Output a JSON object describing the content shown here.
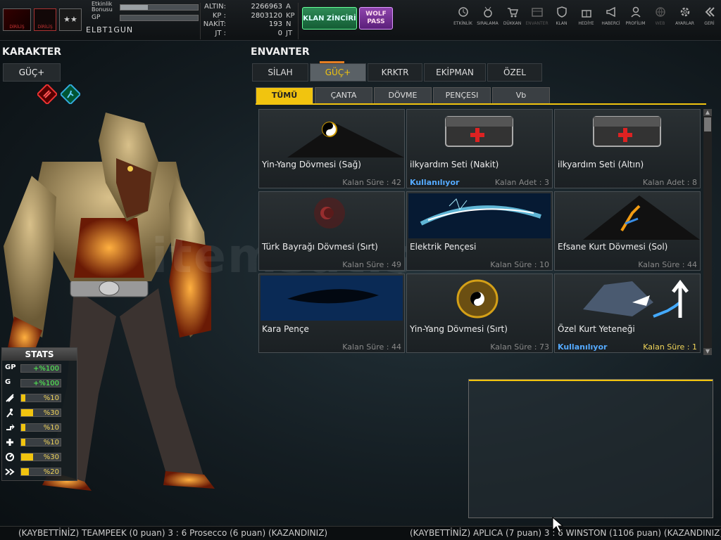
{
  "topbar": {
    "level": {
      "event_bonus_label": "Etkinlik Bonusu",
      "gp_label": "GP",
      "event_bonus_fill": 0.35,
      "gp_fill": 0.0
    },
    "username": "ELBT1GUN",
    "currency": [
      {
        "key": "ALTIN:",
        "value": "2266963",
        "unit": "A"
      },
      {
        "key": "KP :",
        "value": "2803120",
        "unit": "KP"
      },
      {
        "key": "NAKİT:",
        "value": "193",
        "unit": "N"
      },
      {
        "key": "JT :",
        "value": "0",
        "unit": "JT"
      }
    ],
    "klan_zinciri": "KLAN ZİNCİRİ",
    "wolf_pass_line1": "WOLF",
    "wolf_pass_line2": "PASS",
    "nav": [
      {
        "label": "ETKİNLİK",
        "icon": "clock-icon"
      },
      {
        "label": "SIRALAMA",
        "icon": "medal-icon"
      },
      {
        "label": "DÜKKAN",
        "icon": "cart-icon"
      },
      {
        "label": "ENVANTER",
        "icon": "inventory-icon"
      },
      {
        "label": "KLAN",
        "icon": "shield-icon"
      },
      {
        "label": "HEDİYE",
        "icon": "gift-icon"
      },
      {
        "label": "HABERCİ",
        "icon": "megaphone-icon"
      },
      {
        "label": "PROFİLIM",
        "icon": "profile-icon"
      },
      {
        "label": "WEB",
        "icon": "globe-icon"
      },
      {
        "label": "AYARLAR",
        "icon": "gear-icon"
      },
      {
        "label": "GERİ",
        "icon": "back-icon"
      }
    ]
  },
  "left": {
    "title": "KARAKTER",
    "tab": "GÜÇ+",
    "stats_title": "STATS",
    "stats": [
      {
        "icon": "GP",
        "value": "+%100",
        "fill": 0,
        "color": "green"
      },
      {
        "icon": "G",
        "value": "+%100",
        "fill": 0,
        "color": "green"
      },
      {
        "icon": "attack-icon",
        "value": "%10",
        "fill": 0.1,
        "color": "yellow"
      },
      {
        "icon": "run-icon",
        "value": "%30",
        "fill": 0.3,
        "color": "yellow"
      },
      {
        "icon": "jump-icon",
        "value": "%10",
        "fill": 0.1,
        "color": "yellow"
      },
      {
        "icon": "heal-icon",
        "value": "%10",
        "fill": 0.1,
        "color": "yellow"
      },
      {
        "icon": "speed-icon",
        "value": "%30",
        "fill": 0.3,
        "color": "yellow"
      },
      {
        "icon": "dash-icon",
        "value": "%20",
        "fill": 0.2,
        "color": "yellow"
      }
    ]
  },
  "inventory": {
    "title": "ENVANTER",
    "tabs": [
      "SİLAH",
      "GÜÇ+",
      "KRKTR",
      "EKİPMAN",
      "ÖZEL"
    ],
    "active_tab": 1,
    "subtabs": [
      "TÜMÜ",
      "ÇANTA",
      "DÖVME",
      "PENÇESI",
      "Vb"
    ],
    "active_subtab": 0,
    "items": [
      {
        "name": "Yin-Yang Dövmesi (Sağ)",
        "status": "",
        "remain": "Kalan Süre : 42",
        "img": "yinyang-tattoo"
      },
      {
        "name": "ilkyardım Seti (Nakit)",
        "status": "Kullanılıyor",
        "remain": "Kalan Adet : 3",
        "img": "medkit"
      },
      {
        "name": "ilkyardım Seti (Altın)",
        "status": "",
        "remain": "Kalan Adet : 8",
        "img": "medkit"
      },
      {
        "name": "Türk Bayrağı Dövmesi (Sırt)",
        "status": "",
        "remain": "Kalan Süre : 49",
        "img": "turkish-flag-tattoo"
      },
      {
        "name": "Elektrik Pençesi",
        "status": "",
        "remain": "Kalan Süre : 10",
        "img": "electric-claw"
      },
      {
        "name": "Efsane Kurt Dövmesi (Sol)",
        "status": "",
        "remain": "Kalan Süre : 44",
        "img": "wolf-tattoo"
      },
      {
        "name": "Kara Pençe",
        "status": "",
        "remain": "Kalan Süre : 44",
        "img": "black-claw"
      },
      {
        "name": "Yin-Yang Dövmesi (Sırt)",
        "status": "",
        "remain": "Kalan Süre : 73",
        "img": "dragon-tattoo"
      },
      {
        "name": "Özel Kurt Yeteneği",
        "status": "Kullanılıyor",
        "remain": "Kalan Süre : 1",
        "img": "wolf-skill",
        "highlight": true
      }
    ]
  },
  "watermark": "itemsatış",
  "ticker": {
    "msg1": "(KAYBETTİNİZ) TEAMPEEK (0 puan) 3 : 6 Prosecco (6 puan) (KAZANDINIZ)",
    "msg2": "(KAYBETTİNİZ) APLICA (7 puan) 3 : 6 WINSTON (1106 puan) (KAZANDINIZ)"
  }
}
